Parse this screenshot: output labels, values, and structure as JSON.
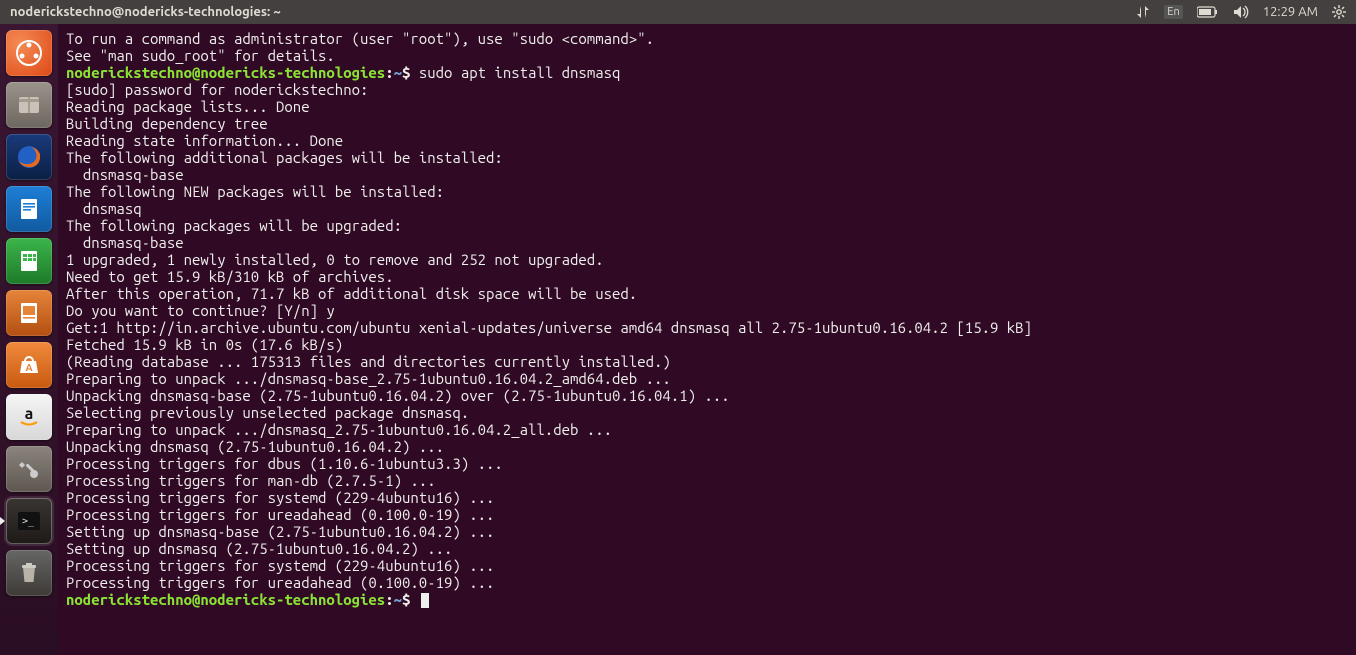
{
  "menubar": {
    "title": "noderickstechno@nodericks-technologies: ~",
    "lang": "En",
    "time": "12:29 AM"
  },
  "launcher": {
    "items": [
      {
        "name": "dash-icon",
        "label": "Dash"
      },
      {
        "name": "files-icon",
        "label": "Files"
      },
      {
        "name": "firefox-icon",
        "label": "Firefox"
      },
      {
        "name": "writer-icon",
        "label": "LibreOffice Writer"
      },
      {
        "name": "calc-icon",
        "label": "LibreOffice Calc"
      },
      {
        "name": "impress-icon",
        "label": "LibreOffice Impress"
      },
      {
        "name": "software-icon",
        "label": "Ubuntu Software"
      },
      {
        "name": "amazon-icon",
        "label": "Amazon"
      },
      {
        "name": "settings-icon",
        "label": "System Settings"
      },
      {
        "name": "terminal-icon",
        "label": "Terminal",
        "active": true
      },
      {
        "name": "trash-icon",
        "label": "Trash"
      }
    ]
  },
  "terminal": {
    "prompt_user_host": "noderickstechno@nodericks-technologies",
    "prompt_path": "~",
    "prompt_symbol": "$",
    "command": "sudo apt install dnsmasq",
    "intro_lines": [
      "To run a command as administrator (user \"root\"), use \"sudo <command>\".",
      "See \"man sudo_root\" for details.",
      ""
    ],
    "output_lines": [
      "[sudo] password for noderickstechno: ",
      "Reading package lists... Done",
      "Building dependency tree       ",
      "Reading state information... Done",
      "The following additional packages will be installed:",
      "  dnsmasq-base",
      "The following NEW packages will be installed:",
      "  dnsmasq",
      "The following packages will be upgraded:",
      "  dnsmasq-base",
      "1 upgraded, 1 newly installed, 0 to remove and 252 not upgraded.",
      "Need to get 15.9 kB/310 kB of archives.",
      "After this operation, 71.7 kB of additional disk space will be used.",
      "Do you want to continue? [Y/n] y",
      "Get:1 http://in.archive.ubuntu.com/ubuntu xenial-updates/universe amd64 dnsmasq all 2.75-1ubuntu0.16.04.2 [15.9 kB]",
      "Fetched 15.9 kB in 0s (17.6 kB/s)  ",
      "(Reading database ... 175313 files and directories currently installed.)",
      "Preparing to unpack .../dnsmasq-base_2.75-1ubuntu0.16.04.2_amd64.deb ...",
      "Unpacking dnsmasq-base (2.75-1ubuntu0.16.04.2) over (2.75-1ubuntu0.16.04.1) ...",
      "Selecting previously unselected package dnsmasq.",
      "Preparing to unpack .../dnsmasq_2.75-1ubuntu0.16.04.2_all.deb ...",
      "Unpacking dnsmasq (2.75-1ubuntu0.16.04.2) ...",
      "Processing triggers for dbus (1.10.6-1ubuntu3.3) ...",
      "Processing triggers for man-db (2.7.5-1) ...",
      "Processing triggers for systemd (229-4ubuntu16) ...",
      "Processing triggers for ureadahead (0.100.0-19) ...",
      "Setting up dnsmasq-base (2.75-1ubuntu0.16.04.2) ...",
      "Setting up dnsmasq (2.75-1ubuntu0.16.04.2) ...",
      "Processing triggers for systemd (229-4ubuntu16) ...",
      "Processing triggers for ureadahead (0.100.0-19) ..."
    ]
  }
}
